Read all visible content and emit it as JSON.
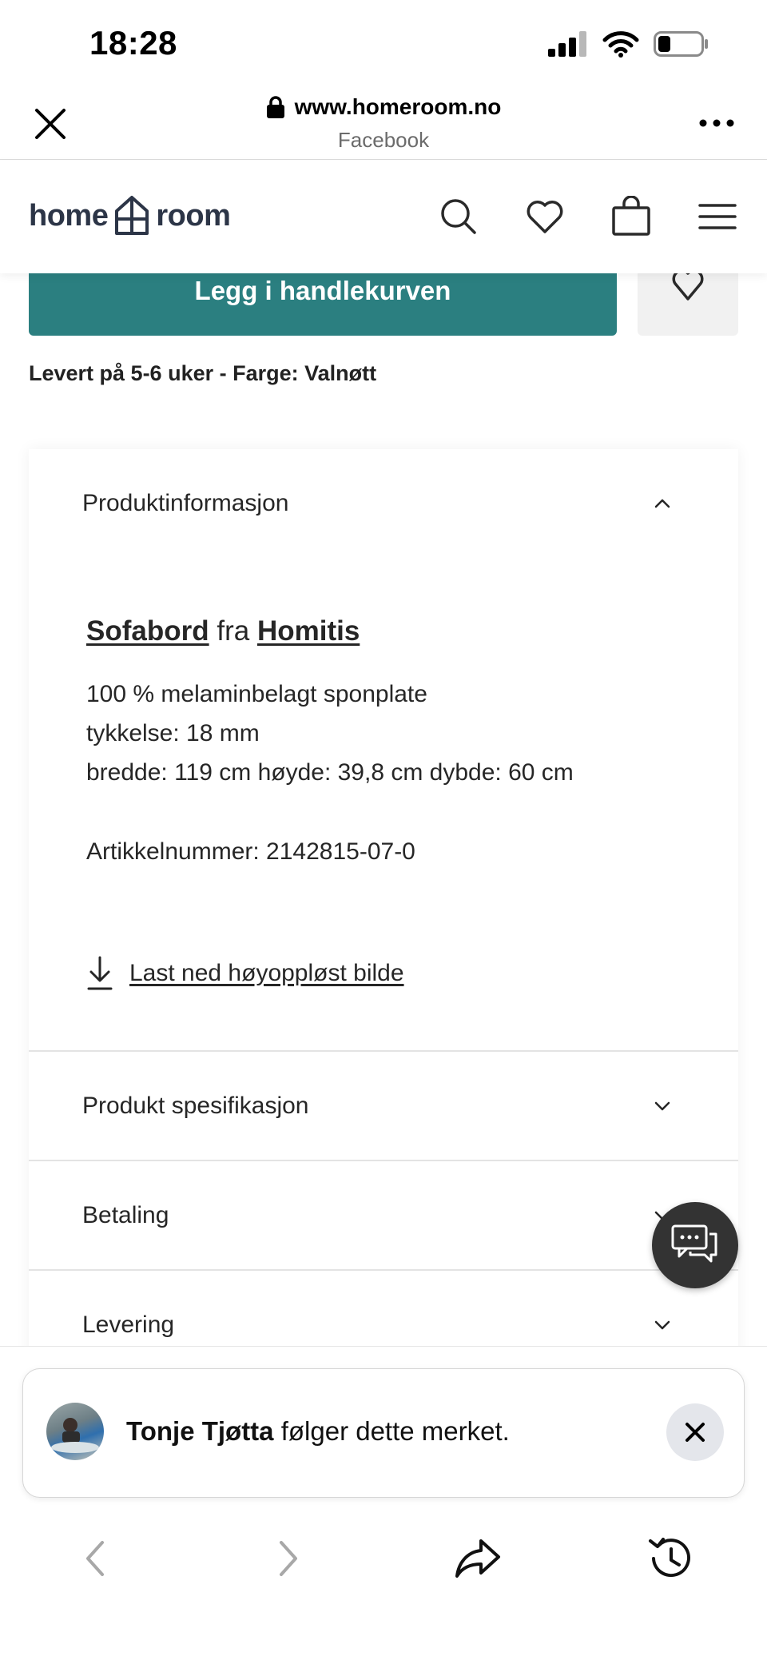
{
  "status": {
    "time": "18:28"
  },
  "browser": {
    "url": "www.homeroom.no",
    "source": "Facebook"
  },
  "site": {
    "logo_left": "home",
    "logo_right": "room"
  },
  "product": {
    "add_to_cart": "Legg i handlekurven",
    "delivery_note": "Levert på 5-6 uker - Farge: Valnøtt"
  },
  "accordion": {
    "product_info": {
      "title": "Produktinformasjon",
      "product_type": "Sofabord",
      "from_word": "fra",
      "brand": "Homitis",
      "lines": [
        "100 % melaminbelagt sponplate",
        "tykkelse: 18 mm",
        "bredde: 119 cm høyde: 39,8 cm dybde: 60 cm"
      ],
      "article_number": "Artikkelnummer: 2142815-07-0",
      "download": "Last ned høyoppløst bilde"
    },
    "sections": [
      "Produkt spesifikasjon",
      "Betaling",
      "Levering"
    ]
  },
  "notification": {
    "name": "Tonje Tjøtta",
    "message": "følger dette merket."
  },
  "icons": {
    "close": "close-icon",
    "lock": "lock-icon",
    "more": "more-icon",
    "search": "search-icon",
    "heart": "heart-icon",
    "bag": "shopping-bag-icon",
    "menu": "menu-icon",
    "chat": "chat-icon",
    "download": "download-icon",
    "back": "back-arrow-icon",
    "forward": "forward-arrow-icon",
    "share": "share-icon",
    "history": "history-icon"
  },
  "colors": {
    "accent": "#2b7f80",
    "chat": "#333333"
  }
}
